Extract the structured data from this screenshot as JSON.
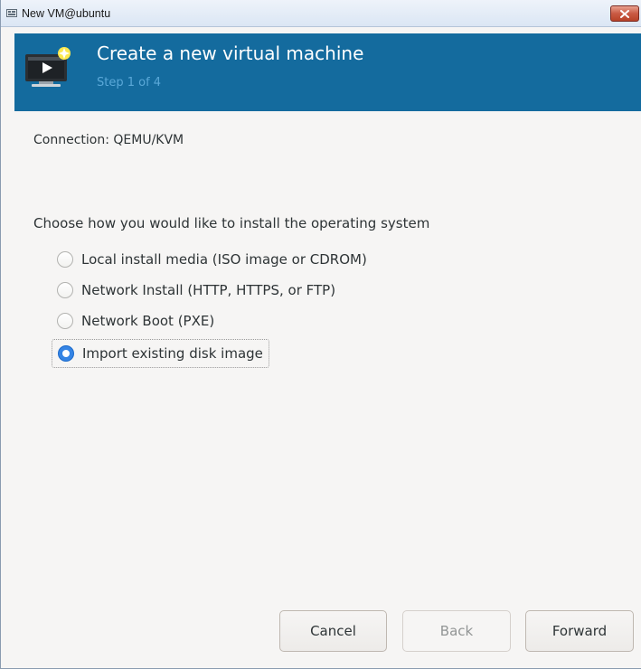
{
  "window": {
    "title": "New VM@ubuntu",
    "close_icon": "close-icon"
  },
  "header": {
    "title": "Create a new virtual machine",
    "step": "Step 1 of 4",
    "icon": "virtual-machine-new-icon",
    "background_color": "#146b9e"
  },
  "connection": {
    "text": "Connection: QEMU/KVM"
  },
  "install": {
    "prompt": "Choose how you would like to install the operating system",
    "selected": "import",
    "options": [
      {
        "id": "local",
        "label": "Local install media (ISO image or CDROM)",
        "checked": false
      },
      {
        "id": "network",
        "label": "Network Install (HTTP, HTTPS, or FTP)",
        "checked": false
      },
      {
        "id": "pxe",
        "label": "Network Boot (PXE)",
        "checked": false
      },
      {
        "id": "import",
        "label": "Import existing disk image",
        "checked": true
      }
    ]
  },
  "buttons": {
    "cancel": "Cancel",
    "back": "Back",
    "forward": "Forward",
    "back_enabled": false
  },
  "colors": {
    "accent": "#3584e4",
    "header": "#146b9e",
    "step_text": "#5aa8d8"
  }
}
